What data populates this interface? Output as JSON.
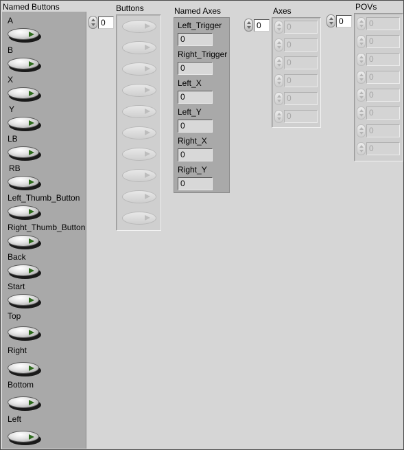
{
  "named_buttons": {
    "caption": "Named Buttons",
    "items": [
      {
        "label": "A"
      },
      {
        "label": "B"
      },
      {
        "label": "X"
      },
      {
        "label": "Y"
      },
      {
        "label": "LB"
      },
      {
        "label": "RB"
      },
      {
        "label": "Left_Thumb_Button"
      },
      {
        "label": "Right_Thumb_Button"
      },
      {
        "label": "Back"
      },
      {
        "label": "Start"
      },
      {
        "label": "Top"
      },
      {
        "label": "Right"
      },
      {
        "label": "Bottom"
      },
      {
        "label": "Left"
      }
    ],
    "led_color": "#2d6a1c"
  },
  "buttons": {
    "caption": "Buttons",
    "index": "0",
    "element_count": 10
  },
  "named_axes": {
    "caption": "Named Axes",
    "items": [
      {
        "label": "Left_Trigger",
        "value": "0"
      },
      {
        "label": "Right_Trigger",
        "value": "0"
      },
      {
        "label": "Left_X",
        "value": "0"
      },
      {
        "label": "Left_Y",
        "value": "0"
      },
      {
        "label": "Right_X",
        "value": "0"
      },
      {
        "label": "Right_Y",
        "value": "0"
      }
    ]
  },
  "axes": {
    "caption": "Axes",
    "index": "0",
    "values": [
      "0",
      "0",
      "0",
      "0",
      "0",
      "0"
    ]
  },
  "povs": {
    "caption": "POVs",
    "index": "0",
    "values": [
      "0",
      "0",
      "0",
      "0",
      "0",
      "0",
      "0",
      "0"
    ]
  },
  "colors": {
    "background": "#d6d6d6",
    "cluster_panel": "#a9a9a9"
  }
}
